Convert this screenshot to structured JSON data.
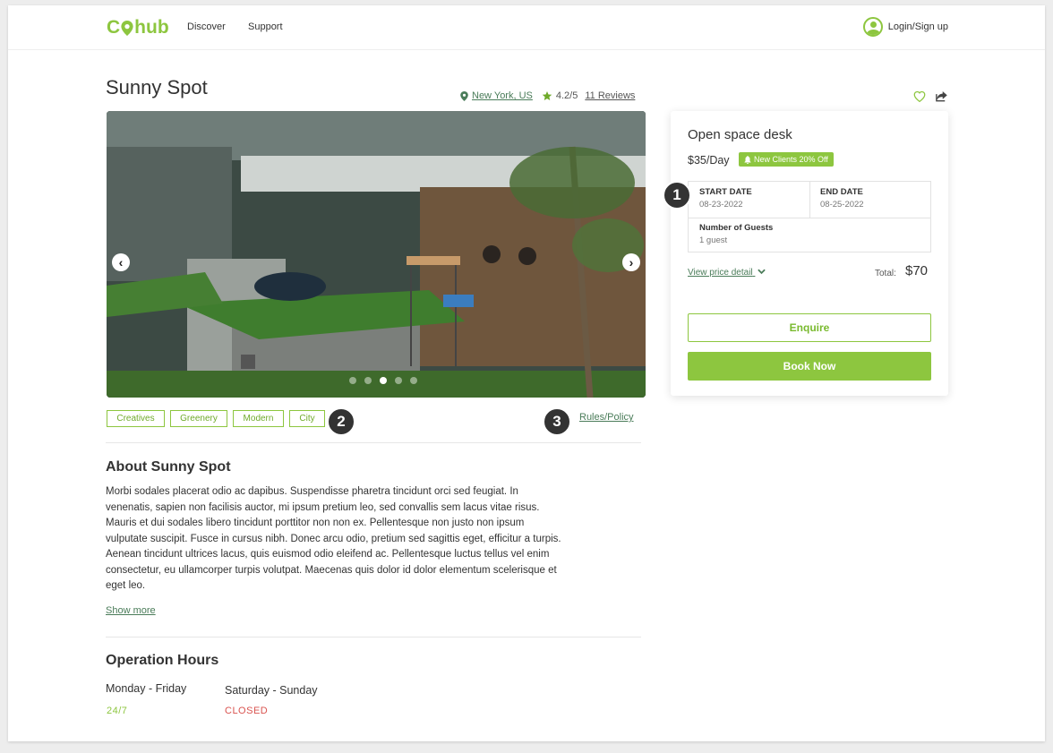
{
  "colors": {
    "brand": "#8dc63f",
    "link": "#4a7c59",
    "closed": "#d9534f"
  },
  "nav": {
    "logo_left": "C",
    "logo_right": "hub",
    "links": [
      "Discover",
      "Support"
    ],
    "login_label": "Login/Sign up"
  },
  "listing": {
    "title": "Sunny Spot",
    "location": "New York, US",
    "rating": "4.2/5",
    "reviews": "11 Reviews"
  },
  "gallery": {
    "image": "coworking-space-photo",
    "slide_count": 5,
    "active_slide": 3
  },
  "tags": [
    "Creatives",
    "Greenery",
    "Modern",
    "City"
  ],
  "rules_label": "Rules/Policy",
  "callouts": [
    "1",
    "2",
    "3"
  ],
  "about": {
    "heading": "About Sunny Spot",
    "lines": [
      "Morbi sodales placerat odio ac dapibus. Suspendisse pharetra tincidunt orci sed feugiat. In",
      "venenatis, sapien non facilisis auctor, mi ipsum pretium leo, sed convallis sem lacus vitae risus.",
      "Mauris et dui sodales libero tincidunt porttitor non non ex. Pellentesque non justo non ipsum",
      "vulputate suscipit. Fusce in cursus nibh. Donec arcu odio, pretium sed sagittis eget, efficitur a turpis.",
      "Aenean tincidunt ultrices lacus, quis euismod odio eleifend ac. Pellentesque luctus tellus vel enim",
      "consectetur, eu ullamcorper turpis volutpat. Maecenas quis dolor id dolor elementum scelerisque et",
      "eget leo."
    ],
    "show_more": "Show more"
  },
  "hours": {
    "heading": "Operation Hours",
    "weekday_label": "Monday - Friday",
    "weekday_value": "24/7",
    "weekend_label": "Saturday - Sunday",
    "weekend_value": "CLOSED"
  },
  "booking": {
    "title": "Open space desk",
    "price": "$35/Day",
    "promo": "New Clients 20% Off",
    "start_label": "START DATE",
    "start_value": "08-23-2022",
    "end_label": "END DATE",
    "end_value": "08-25-2022",
    "guests_label": "Number of Guests",
    "guests_value": "1 guest",
    "price_detail": "View price detail",
    "total_label": "Total:",
    "total_value": "$70",
    "enquire": "Enquire",
    "book_now": "Book Now"
  }
}
